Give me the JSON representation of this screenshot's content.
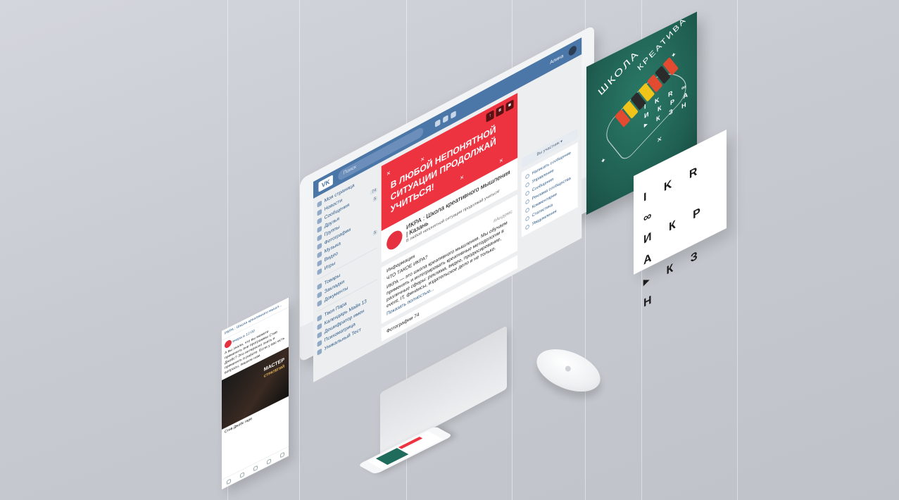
{
  "vk": {
    "search_placeholder": "Поиск",
    "username": "Алина",
    "logo": "VK",
    "left_menu": [
      {
        "label": "Моя страница",
        "count": ""
      },
      {
        "label": "Новости",
        "count": ""
      },
      {
        "label": "Сообщения",
        "count": "74"
      },
      {
        "label": "Друзья",
        "count": "5"
      },
      {
        "label": "Группы",
        "count": ""
      },
      {
        "label": "Фотографии",
        "count": ""
      },
      {
        "label": "Музыка",
        "count": ""
      },
      {
        "label": "Видео",
        "count": "5"
      },
      {
        "label": "Игры",
        "count": ""
      }
    ],
    "left_menu_2": [
      {
        "label": "Товары"
      },
      {
        "label": "Закладки"
      },
      {
        "label": "Документы"
      }
    ],
    "left_menu_3": [
      {
        "label": "Твоя Пара"
      },
      {
        "label": "Календарь Майя 13"
      },
      {
        "label": "Дешифратор имен"
      },
      {
        "label": "Психоматрица"
      },
      {
        "label": "Уникальный Тест"
      }
    ],
    "cover_text": "В ЛЮБОЙ НЕПОНЯТНОЙ СИТУАЦИИ ПРОДОЛЖАЙ УЧИТЬСЯ!",
    "group_title": "ИКРА : Школа креативного мышления | Казань",
    "group_status": "В любой непонятной ситуации продолжай учиться!",
    "info_heading": "Информация",
    "info_question": "ЧТО ТАКОЕ ИКРА?",
    "info_tag": "#Андемс",
    "info_body": "ИКРА — это школа креативного мышления. Мы обучаем применять и интегрировать креативные методологии в различные сферы: реклама, видео, продюсирование, event, IT, финансы, издательское дело и не только.",
    "show_more": "Показать полностью...",
    "photos_label": "Фотографии",
    "photos_count": "74",
    "member_button": "Вы участник ▾",
    "right_menu": [
      "Написать сообщение",
      "Управление",
      "Сообщения",
      "Реклама сообщества",
      "Комментарии",
      "Статистика",
      "Уведомления"
    ]
  },
  "mobile": {
    "header": "ИКРА : Школа креативного мышл...",
    "post_meta": "вчера в 12:00",
    "post_text": "А вы знали, что вы можете применить вне программы Стив Джобс? Это интересно знать и применять в работе. Если у вас есть вопросы, пишите нам.",
    "photo_title": "МАСТЕР",
    "photo_subtitle": "СТРАТЕГИЙ",
    "caption": "Стив Джобс гаре"
  },
  "poster": {
    "line1": "ШКОЛА",
    "line2": "КРЕАТИВА",
    "logo_lines": [
      "I K R ∞",
      "И К Р А",
      "▸ К З Н"
    ]
  },
  "logo_card": {
    "lines": [
      "I K R ∞",
      "И К Р А",
      "▸ К З Н"
    ]
  },
  "colors": {
    "vk_blue": "#4a76a8",
    "cover_red": "#ee3340",
    "poster_green": "#1f5f51"
  }
}
